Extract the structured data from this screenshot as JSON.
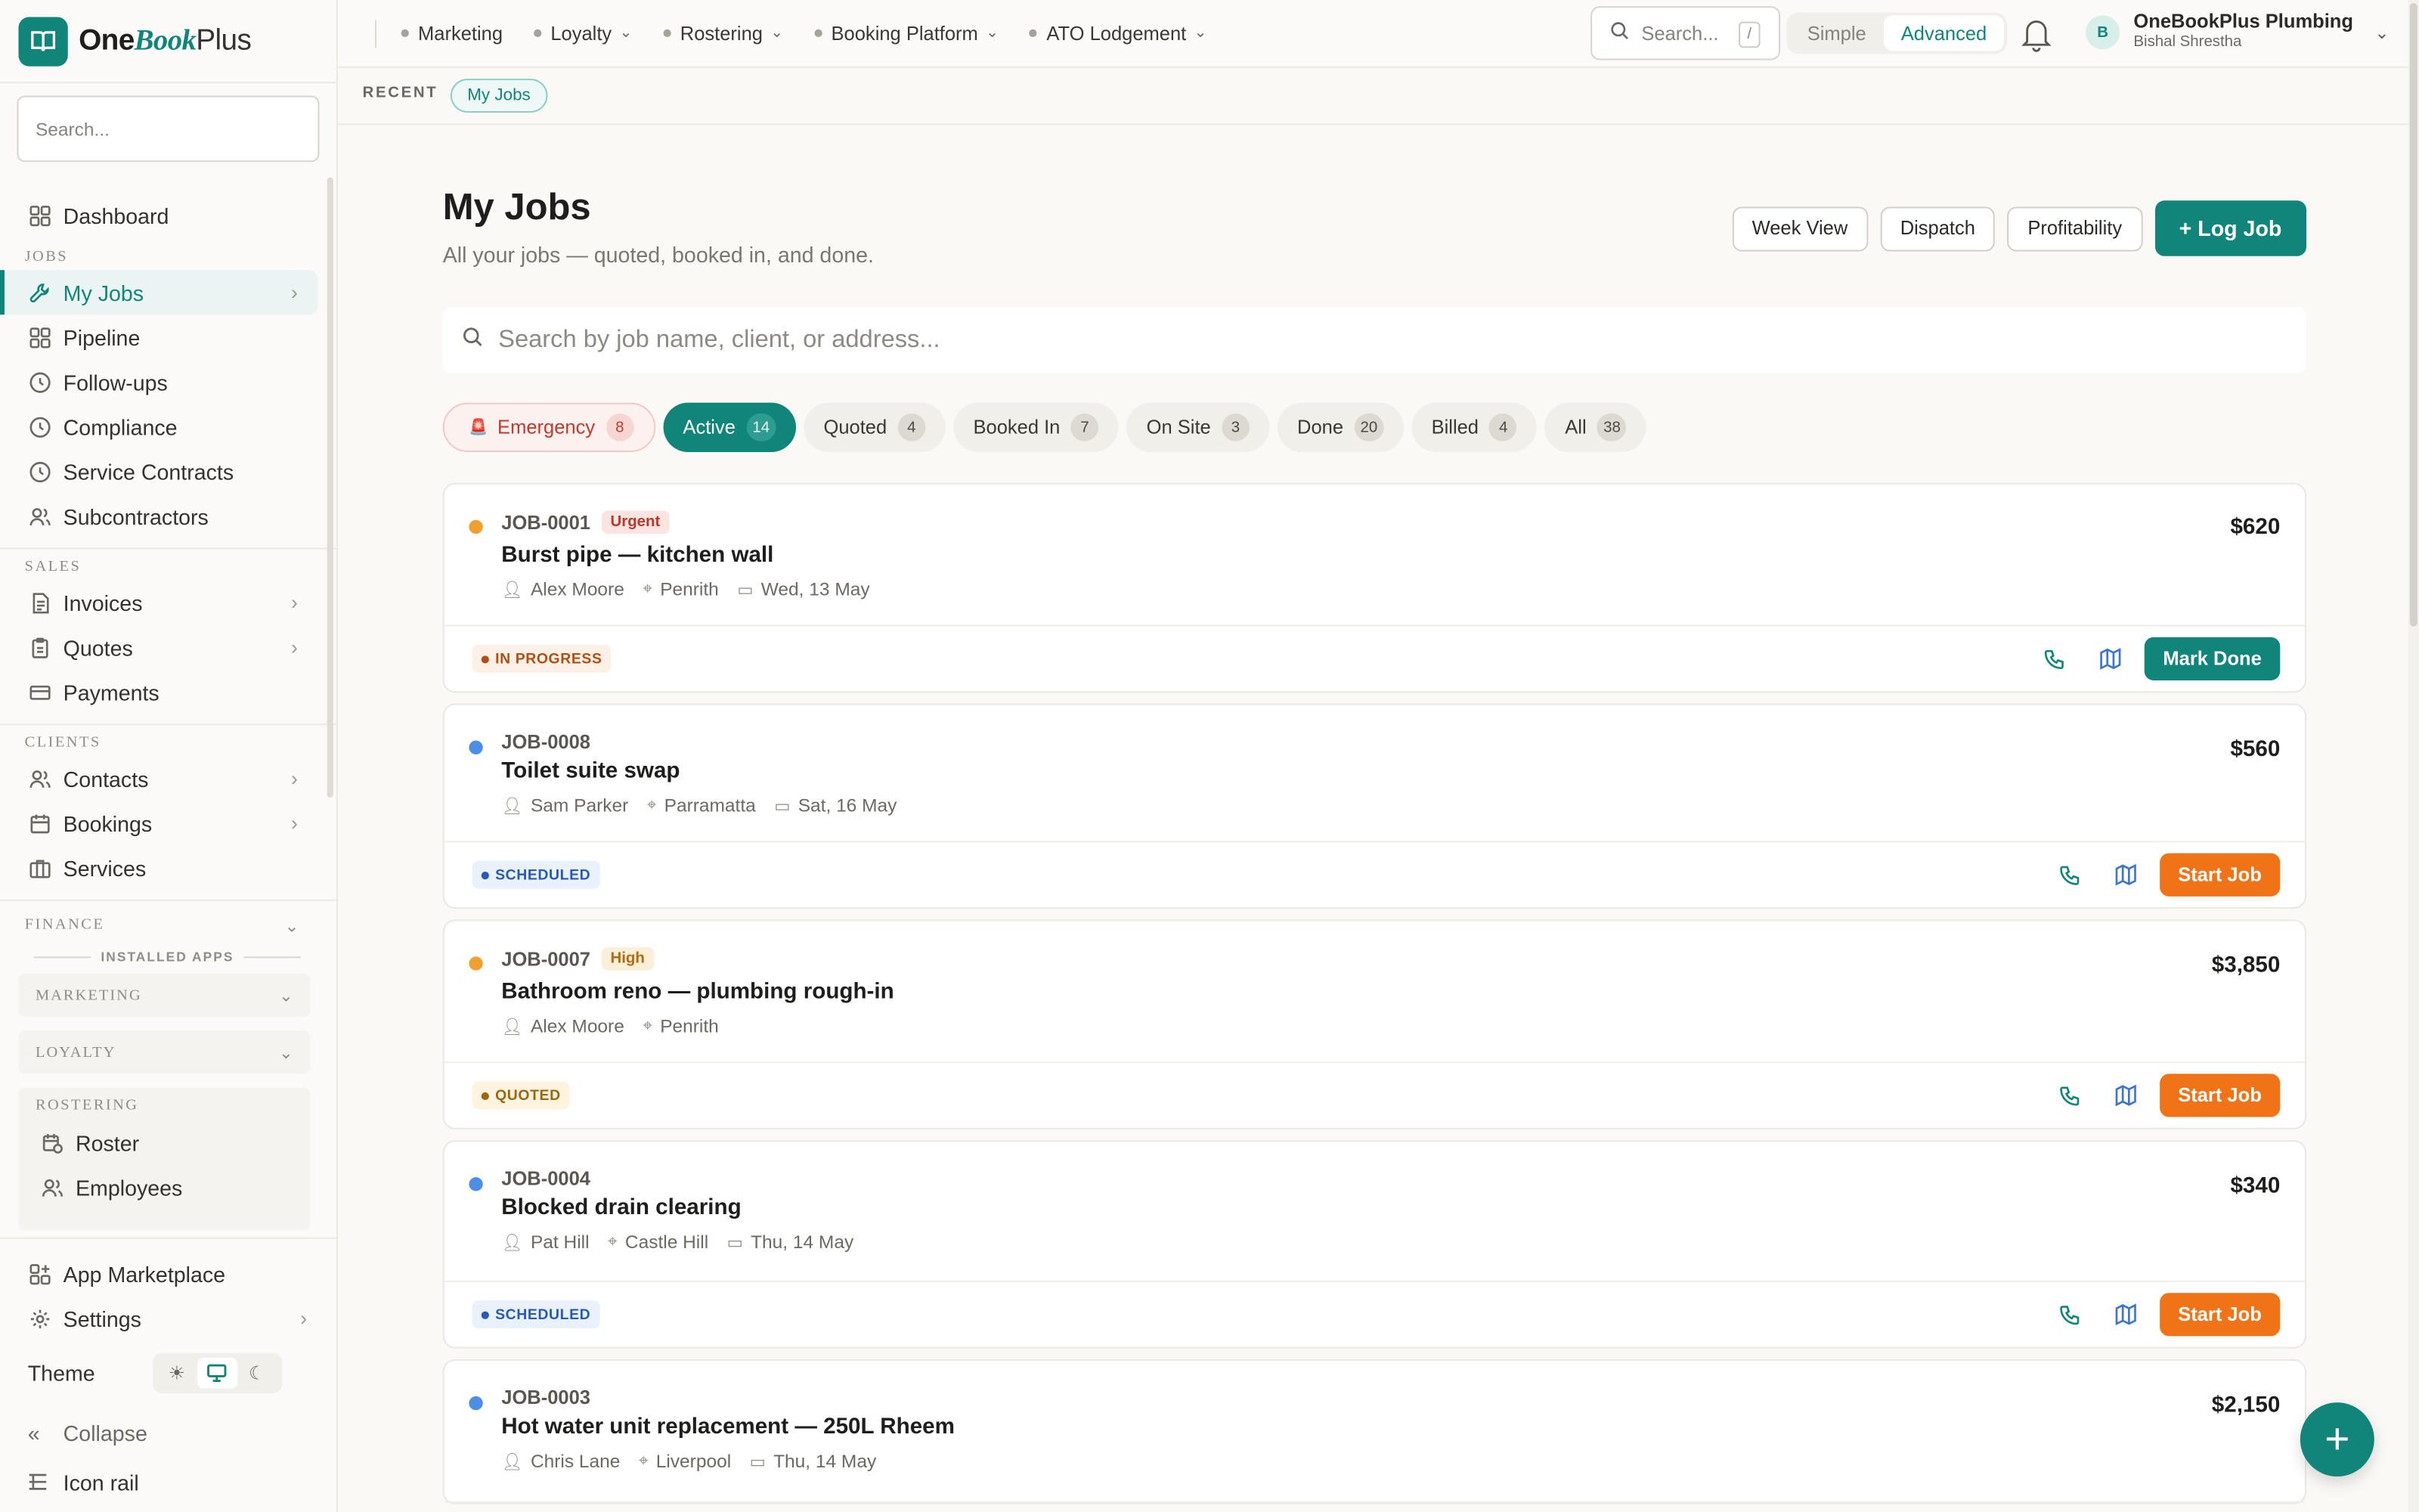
{
  "brand": {
    "one": "One",
    "book": "Book",
    "plus": "Plus"
  },
  "sidebar": {
    "search_placeholder": "Search...",
    "dashboard": "Dashboard",
    "sections": {
      "jobs": "JOBS",
      "sales": "SALES",
      "clients": "CLIENTS",
      "finance": "FINANCE"
    },
    "jobs_items": [
      "My Jobs",
      "Pipeline",
      "Follow-ups",
      "Compliance",
      "Service Contracts",
      "Subcontractors"
    ],
    "sales_items": [
      "Invoices",
      "Quotes",
      "Payments"
    ],
    "clients_items": [
      "Contacts",
      "Bookings",
      "Services"
    ],
    "installed_apps": "INSTALLED APPS",
    "apps": {
      "marketing": "MARKETING",
      "loyalty": "LOYALTY",
      "rostering": "ROSTERING"
    },
    "rostering_items": [
      "Roster",
      "Employees"
    ],
    "app_marketplace": "App Marketplace",
    "settings": "Settings",
    "theme": "Theme",
    "collapse": "Collapse",
    "icon_rail": "Icon rail"
  },
  "topbar": {
    "links": [
      "Marketing",
      "Loyalty",
      "Rostering",
      "Booking Platform",
      "ATO Lodgement"
    ],
    "search_placeholder": "Search...",
    "search_kbd": "/",
    "mode_simple": "Simple",
    "mode_advanced": "Advanced",
    "avatar_initial": "B",
    "org": "OneBookPlus Plumbing",
    "user": "Bishal Shrestha"
  },
  "recent": {
    "label": "RECENT",
    "chip": "My Jobs"
  },
  "page": {
    "title": "My Jobs",
    "subtitle": "All your jobs — quoted, booked in, and done.",
    "btn_week": "Week View",
    "btn_dispatch": "Dispatch",
    "btn_profit": "Profitability",
    "btn_log": "+ Log Job",
    "search_placeholder": "Search by job name, client, or address..."
  },
  "filters": [
    {
      "label": "Emergency",
      "count": "8"
    },
    {
      "label": "Active",
      "count": "14"
    },
    {
      "label": "Quoted",
      "count": "4"
    },
    {
      "label": "Booked In",
      "count": "7"
    },
    {
      "label": "On Site",
      "count": "3"
    },
    {
      "label": "Done",
      "count": "20"
    },
    {
      "label": "Billed",
      "count": "4"
    },
    {
      "label": "All",
      "count": "38"
    }
  ],
  "jobs": [
    {
      "code": "JOB-0001",
      "priority": "Urgent",
      "title": "Burst pipe — kitchen wall",
      "client": "Alex Moore",
      "suburb": "Penrith",
      "date": "Wed, 13 May",
      "amount": "$620",
      "status": "IN PROGRESS",
      "action": "Mark Done"
    },
    {
      "code": "JOB-0008",
      "priority": "",
      "title": "Toilet suite swap",
      "client": "Sam Parker",
      "suburb": "Parramatta",
      "date": "Sat, 16 May",
      "amount": "$560",
      "status": "SCHEDULED",
      "action": "Start Job"
    },
    {
      "code": "JOB-0007",
      "priority": "High",
      "title": "Bathroom reno — plumbing rough-in",
      "client": "Alex Moore",
      "suburb": "Penrith",
      "date": "",
      "amount": "$3,850",
      "status": "QUOTED",
      "action": "Start Job"
    },
    {
      "code": "JOB-0004",
      "priority": "",
      "title": "Blocked drain clearing",
      "client": "Pat Hill",
      "suburb": "Castle Hill",
      "date": "Thu, 14 May",
      "amount": "$340",
      "status": "SCHEDULED",
      "action": "Start Job"
    },
    {
      "code": "JOB-0003",
      "priority": "",
      "title": "Hot water unit replacement — 250L Rheem",
      "client": "Chris Lane",
      "suburb": "Liverpool",
      "date": "Thu, 14 May",
      "amount": "$2,150",
      "status": "",
      "action": ""
    }
  ],
  "colors": {
    "accent": "#12857a",
    "orange": "#f07318",
    "urgent_dot": "#f0a030",
    "scheduled_dot": "#4d8fe6"
  },
  "icons": [
    "search-icon",
    "dashboard-icon",
    "wrench-icon",
    "bell-icon",
    "phone-icon",
    "map-icon",
    "plus-icon",
    "sun-icon",
    "monitor-icon",
    "moon-icon"
  ]
}
